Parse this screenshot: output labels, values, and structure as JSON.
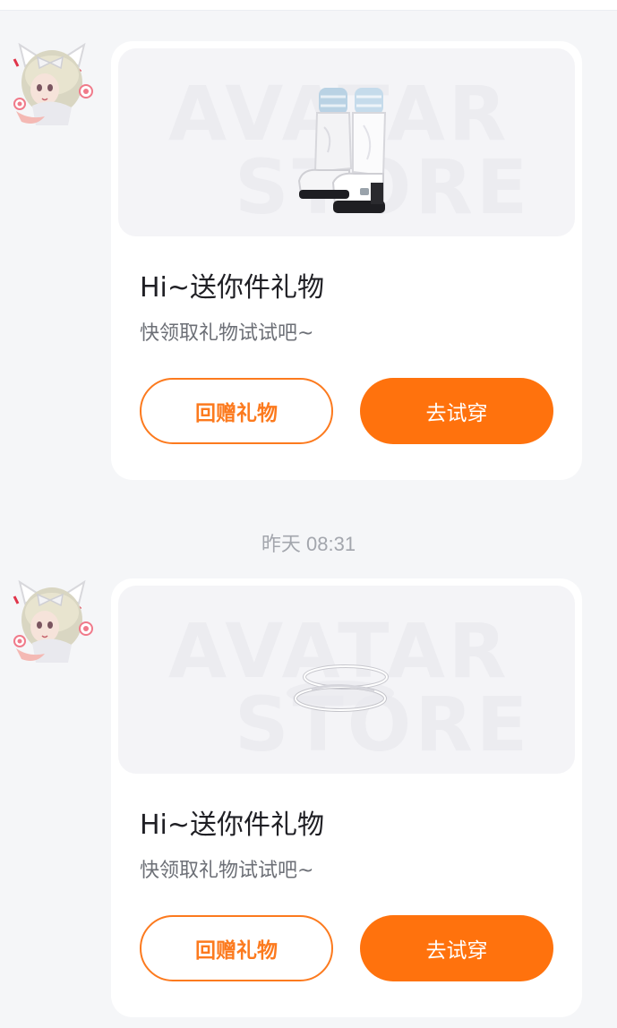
{
  "colors": {
    "accent": "#ff720d",
    "accent_outline": "#fc7a1e",
    "background": "#f5f6f8",
    "card": "#ffffff"
  },
  "messages": [
    {
      "timestamp": "",
      "avatar_icon": "avatar-girl-cat-ears",
      "watermark_line1": "AVATAR",
      "watermark_line2": "STORE",
      "product_icon": "white-boots-icon",
      "title": "Hi~送你件礼物",
      "subtitle": "快领取礼物试试吧~",
      "return_gift_label": "回赠礼物",
      "try_on_label": "去试穿"
    },
    {
      "timestamp": "昨天 08:31",
      "avatar_icon": "avatar-girl-cat-ears",
      "watermark_line1": "AVATAR",
      "watermark_line2": "STORE",
      "product_icon": "halo-rings-icon",
      "title": "Hi~送你件礼物",
      "subtitle": "快领取礼物试试吧~",
      "return_gift_label": "回赠礼物",
      "try_on_label": "去试穿"
    }
  ]
}
